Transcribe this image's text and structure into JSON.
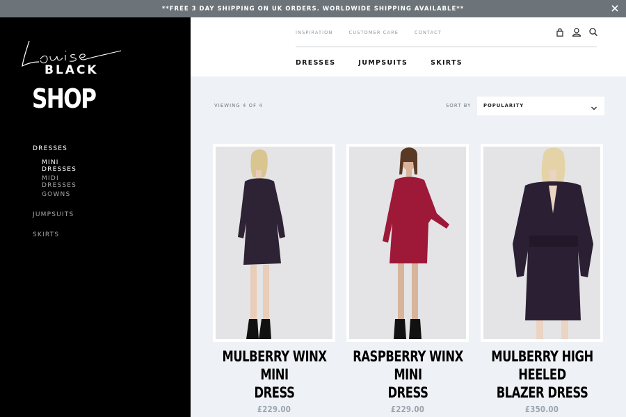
{
  "announcement": {
    "text": "**FREE 3 DAY SHIPPING ON UK ORDERS. WORLDWIDE SHIPPING AVAILABLE**"
  },
  "brand": {
    "script": "Louise",
    "word": "BLACK"
  },
  "sidebar": {
    "title": "SHOP",
    "items": [
      {
        "label": "DRESSES"
      },
      {
        "label": "MINI DRESSES"
      },
      {
        "label": "MIDI DRESSES"
      },
      {
        "label": "GOWNS"
      },
      {
        "label": "JUMPSUITS"
      },
      {
        "label": "SKIRTS"
      }
    ]
  },
  "header": {
    "top_links": [
      "INSPIRATION",
      "CUSTOMER CARE",
      "CONTACT"
    ],
    "nav": [
      "DRESSES",
      "JUMPSUITS",
      "SKIRTS"
    ],
    "icons": [
      "bag-icon",
      "account-icon",
      "search-icon"
    ]
  },
  "toolbar": {
    "viewing": "VIEWING 4 OF 4",
    "sort_label": "SORT BY",
    "sort_value": "POPULARITY"
  },
  "products": [
    {
      "name_line1": "MULBERRY WINX MINI",
      "name_line2": "DRESS",
      "price": "£229.00",
      "color": "#2e2235"
    },
    {
      "name_line1": "RASPBERRY WINX MINI",
      "name_line2": "DRESS",
      "price": "£229.00",
      "color": "#9e1838"
    },
    {
      "name_line1": "MULBERRY HIGH HEELED",
      "name_line2": "BLAZER DRESS",
      "price": "£350.00",
      "color": "#2a1f33"
    }
  ],
  "colors": {
    "sidebar_bg": "#000000",
    "announce_bg": "#6d7479",
    "page_bg": "#eef1f5",
    "price": "#9aa4ae"
  }
}
